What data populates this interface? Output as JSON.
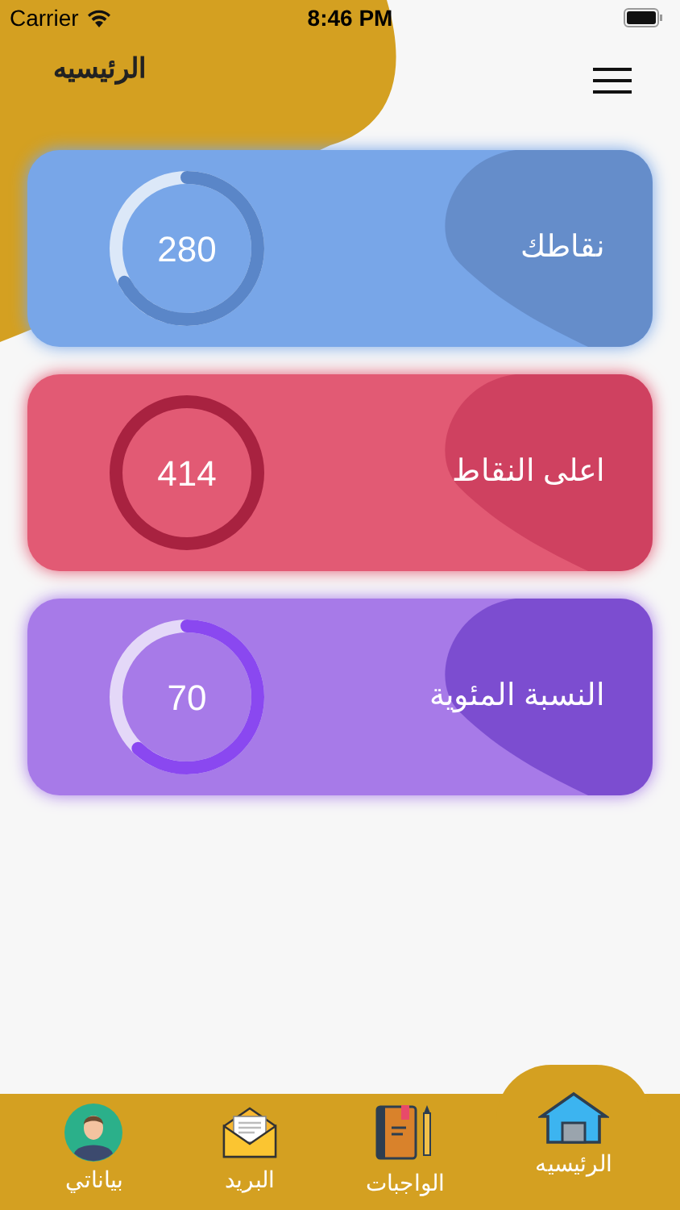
{
  "status_bar": {
    "carrier": "Carrier",
    "time": "8:46 PM"
  },
  "header": {
    "title": "الرئيسيه"
  },
  "cards": [
    {
      "label": "نقاطك",
      "value": "280",
      "level": 0.67,
      "color": "#78a6e8"
    },
    {
      "label": "اعلى النقاط",
      "value": "414",
      "color": "#e25a74"
    },
    {
      "label": "النسبة المئوية",
      "value": "70",
      "level": 0.62,
      "color": "#a77ae8"
    }
  ],
  "tab_bar": [
    {
      "label": "الرئيسيه",
      "kind": "home",
      "selected": true
    },
    {
      "label": "الواجبات",
      "kind": "homework",
      "selected": false
    },
    {
      "label": "البريد",
      "kind": "mail",
      "selected": false
    },
    {
      "label": "بياناتي",
      "kind": "profile",
      "selected": false
    }
  ]
}
